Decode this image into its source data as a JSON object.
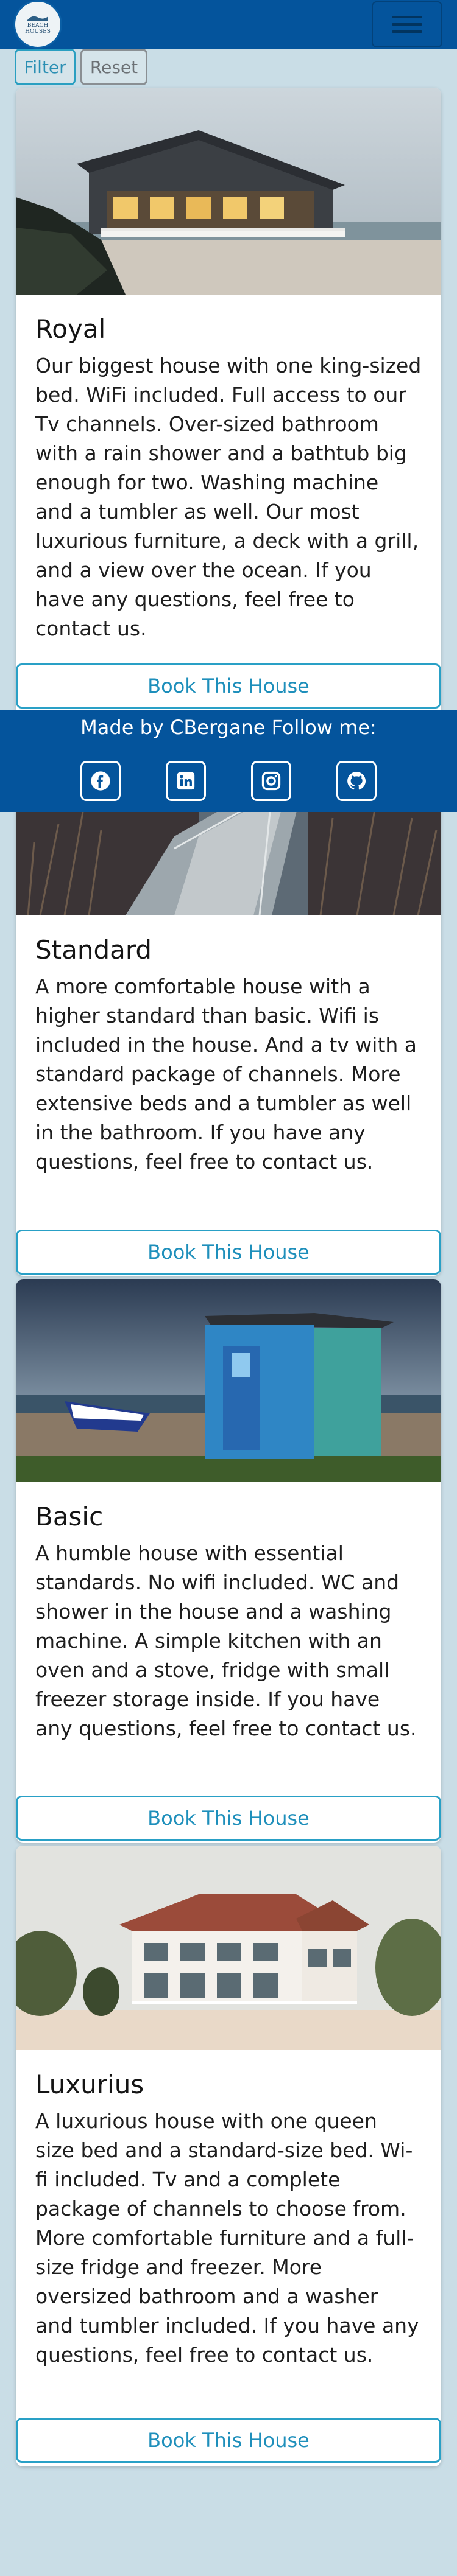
{
  "nav": {
    "logo_text": "BEACH HOUSES"
  },
  "filters": {
    "filter_label": "Filter",
    "reset_label": "Reset"
  },
  "houses": [
    {
      "title": "Royal",
      "description": "Our biggest house with one king-sized bed. WiFi included. Full access to our Tv channels. Over-sized bathroom with a rain shower and a bathtub big enough for two. Washing machine and a tumbler as well. Our most luxurious furniture, a deck with a grill, and a view over the ocean. If you have any questions, feel free to contact us.",
      "button": "Book This House"
    },
    {
      "title": "Standard",
      "description": "A more comfortable house with a higher standard than basic. Wifi is included in the house. And a tv with a standard package of channels. More extensive beds and a tumbler as well in the bathroom. If you have any questions, feel free to contact us.",
      "button": "Book This House"
    },
    {
      "title": "Basic",
      "description": "A humble house with essential standards. No wifi included. WC and shower in the house and a washing machine. A simple kitchen with an oven and a stove, fridge with small freezer storage inside. If you have any questions, feel free to contact us.",
      "button": "Book This House"
    },
    {
      "title": "Luxurius",
      "description": "A luxurious house with one queen size bed and a standard-size bed. Wi-fi included. Tv and a complete package of channels to choose from. More comfortable furniture and a full-size fridge and freezer. More oversized bathroom and a washer and tumbler included. If you have any questions, feel free to contact us.",
      "button": "Book This House"
    }
  ],
  "footer": {
    "text": "Made by CBergane Follow me:",
    "socials": [
      "facebook-icon",
      "linkedin-icon",
      "instagram-icon",
      "github-icon"
    ]
  },
  "colors": {
    "brand": "#04549c",
    "accent": "#29a0c6",
    "background": "#c9dde6"
  }
}
